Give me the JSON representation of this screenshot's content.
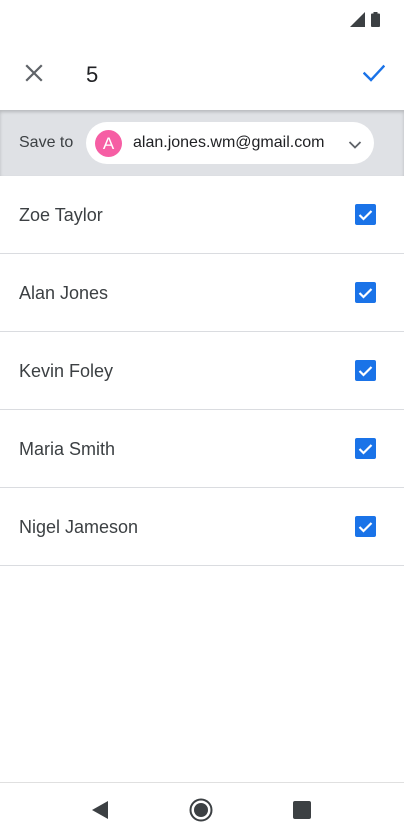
{
  "status_bar": {
    "icons": [
      "signal-icon",
      "battery-icon"
    ]
  },
  "header": {
    "title": "5",
    "close_icon": "close-icon",
    "confirm_icon": "check-icon"
  },
  "save_to": {
    "label": "Save to",
    "account": {
      "avatar_letter": "A",
      "avatar_color": "#f65ea4",
      "email": "alan.jones.wm@gmail.com"
    }
  },
  "contacts": [
    {
      "name": "Zoe Taylor",
      "checked": true
    },
    {
      "name": "Alan Jones",
      "checked": true
    },
    {
      "name": "Kevin Foley",
      "checked": true
    },
    {
      "name": "Maria Smith",
      "checked": true
    },
    {
      "name": "Nigel Jameson",
      "checked": true
    }
  ],
  "colors": {
    "accent": "#1a73e8",
    "save_bar_bg": "#dfe1e5",
    "divider": "#dadce0"
  },
  "nav_bar": {
    "icons": [
      "back-icon",
      "home-icon",
      "recents-icon"
    ]
  }
}
